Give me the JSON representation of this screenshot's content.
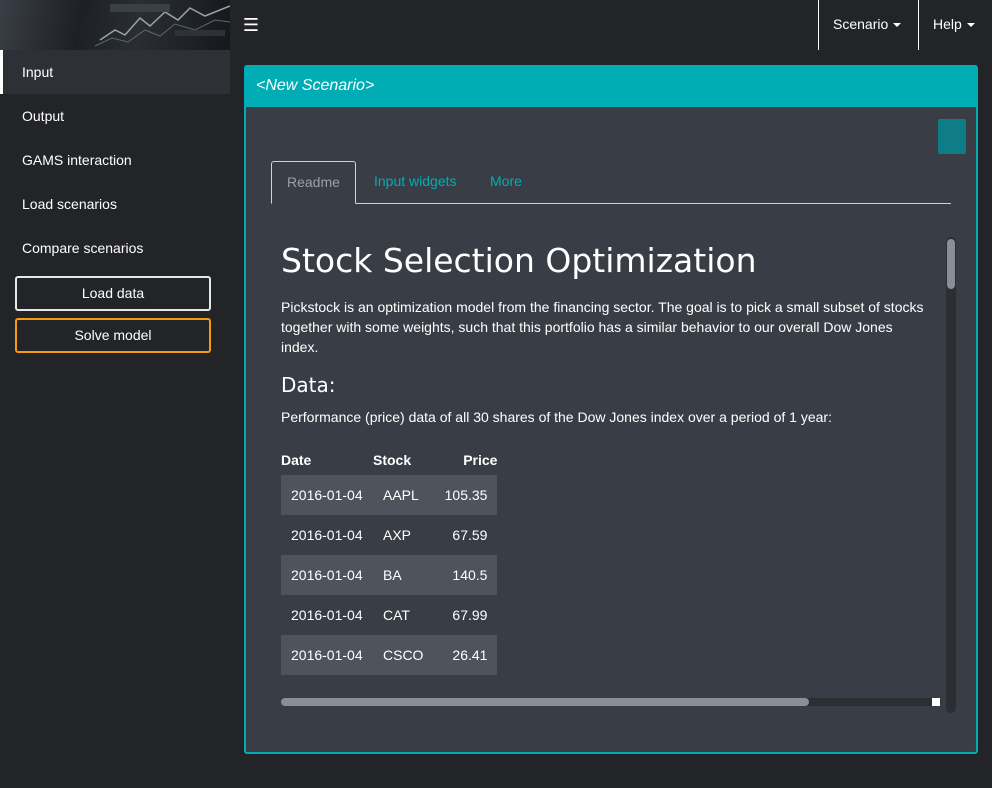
{
  "header": {
    "menu_toggle_icon": "hamburger-icon",
    "menus": [
      {
        "label": "Scenario"
      },
      {
        "label": "Help"
      }
    ]
  },
  "sidebar": {
    "items": [
      {
        "label": "Input",
        "active": true
      },
      {
        "label": "Output"
      },
      {
        "label": "GAMS interaction"
      },
      {
        "label": "Load scenarios"
      },
      {
        "label": "Compare scenarios"
      }
    ],
    "buttons": {
      "load_data": "Load data",
      "solve_model": "Solve model"
    }
  },
  "box": {
    "title": "<New Scenario>",
    "tabs": [
      {
        "label": "Readme",
        "active": true
      },
      {
        "label": "Input widgets"
      },
      {
        "label": "More"
      }
    ]
  },
  "readme": {
    "title": "Stock Selection Optimization",
    "intro": "Pickstock is an optimization model from the financing sector. The goal is to pick a small subset of stocks together with some weights, such that this portfolio has a similar behavior to our overall Dow Jones index.",
    "data_heading": "Data:",
    "data_desc": "Performance (price) data of all 30 shares of the Dow Jones index over a period of 1 year:",
    "table": {
      "headers": [
        "Date",
        "Stock",
        "Price"
      ],
      "rows": [
        [
          "2016-01-04",
          "AAPL",
          "105.35"
        ],
        [
          "2016-01-04",
          "AXP",
          "67.59"
        ],
        [
          "2016-01-04",
          "BA",
          "140.5"
        ],
        [
          "2016-01-04",
          "CAT",
          "67.99"
        ],
        [
          "2016-01-04",
          "CSCO",
          "26.41"
        ]
      ]
    }
  },
  "colors": {
    "accent": "#00adb5",
    "background": "#222427",
    "panel": "#393e46",
    "solve_border": "#f39c12"
  }
}
